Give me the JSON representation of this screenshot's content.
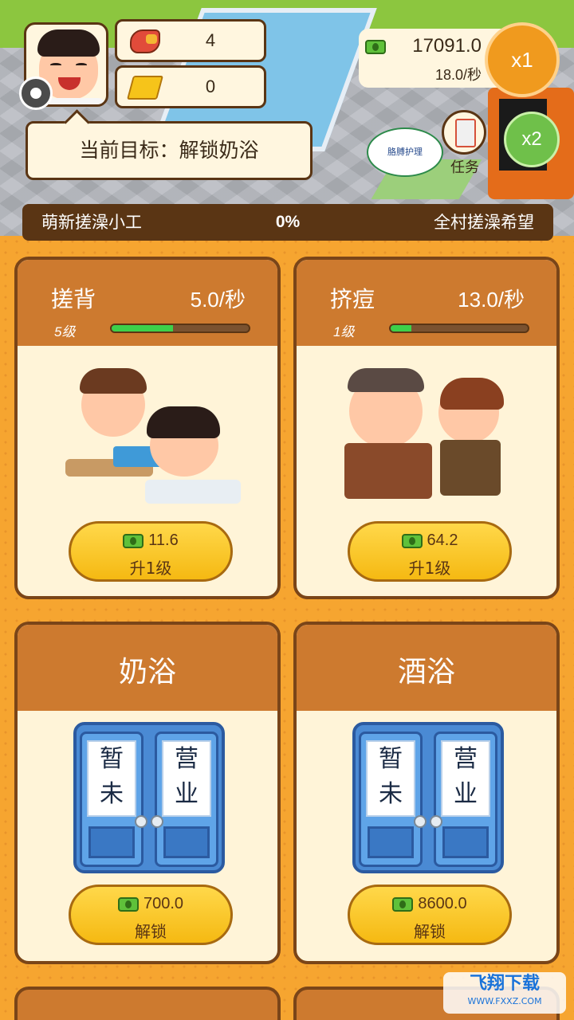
{
  "goal": {
    "text": "当前目标：解锁奶浴"
  },
  "resources": {
    "muscle": "4",
    "gold": "0"
  },
  "money": {
    "amount": "17091.0",
    "rate": "18.0/秒"
  },
  "multipliers": {
    "x1": "x1",
    "x2": "x2"
  },
  "task": {
    "label": "任务"
  },
  "scene": {
    "bubble": "胳膊护理"
  },
  "progress": {
    "left": "萌新搓澡小工",
    "percent": "0%",
    "right": "全村搓澡希望"
  },
  "cards": [
    {
      "title": "搓背",
      "rate": "5.0/秒",
      "level": "5级",
      "progress": 0.45,
      "cost": "11.6",
      "action": "升1级"
    },
    {
      "title": "挤痘",
      "rate": "13.0/秒",
      "level": "1级",
      "progress": 0.15,
      "cost": "64.2",
      "action": "升1级"
    }
  ],
  "locked": [
    {
      "title": "奶浴",
      "door_left": "暂未",
      "door_right": "营业",
      "cost": "700.0",
      "action": "解锁"
    },
    {
      "title": "酒浴",
      "door_left": "暂未",
      "door_right": "营业",
      "cost": "8600.0",
      "action": "解锁"
    }
  ],
  "watermark": {
    "title": "飞翔下载",
    "url": "WWW.FXXZ.COM"
  },
  "colors": {
    "accent": "#f6a530",
    "panel": "#cd7a2f",
    "border": "#7a4518",
    "cash": "#5fc13a",
    "progress": "#3dd14a"
  }
}
